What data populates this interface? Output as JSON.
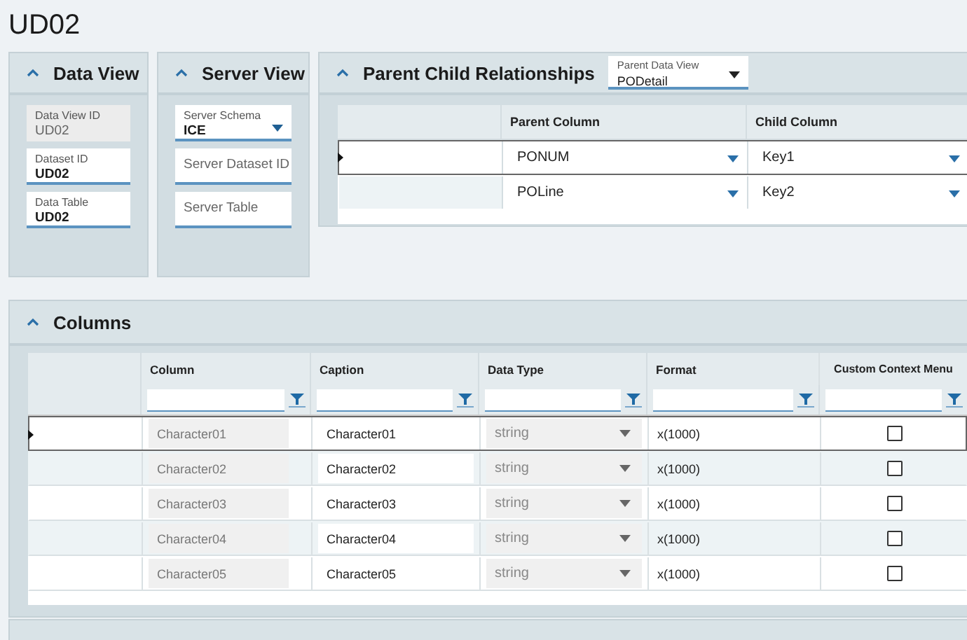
{
  "page": {
    "title": "UD02"
  },
  "data_view": {
    "title": "Data View",
    "fields": [
      {
        "label": "Data View ID",
        "value": "UD02",
        "disabled": true
      },
      {
        "label": "Dataset ID",
        "value": "UD02",
        "disabled": false
      },
      {
        "label": "Data Table",
        "value": "UD02",
        "disabled": false
      }
    ]
  },
  "server_view": {
    "title": "Server View",
    "fields": [
      {
        "kind": "dropdown",
        "label": "Server Schema",
        "value": "ICE"
      },
      {
        "kind": "text",
        "placeholder": "Server Dataset ID"
      },
      {
        "kind": "text",
        "placeholder": "Server Table"
      }
    ]
  },
  "relationships": {
    "title": "Parent Child Relationships",
    "parent_data_view": {
      "label": "Parent Data View",
      "value": "PODetail"
    },
    "columns": [
      "Parent Column",
      "Child Column"
    ],
    "rows": [
      {
        "parent_column": "PONUM",
        "child_column": "Key1",
        "selected": true
      },
      {
        "parent_column": "POLine",
        "child_column": "Key2",
        "selected": false
      }
    ]
  },
  "columns_panel": {
    "title": "Columns",
    "columns": [
      "Column",
      "Caption",
      "Data Type",
      "Format",
      "Custom Context Menu"
    ],
    "rows": [
      {
        "column": "Character01",
        "caption": "Character01",
        "data_type": "string",
        "format": "x(1000)",
        "custom_context_menu": false,
        "selected": true
      },
      {
        "column": "Character02",
        "caption": "Character02",
        "data_type": "string",
        "format": "x(1000)",
        "custom_context_menu": false,
        "selected": false
      },
      {
        "column": "Character03",
        "caption": "Character03",
        "data_type": "string",
        "format": "x(1000)",
        "custom_context_menu": false,
        "selected": false
      },
      {
        "column": "Character04",
        "caption": "Character04",
        "data_type": "string",
        "format": "x(1000)",
        "custom_context_menu": false,
        "selected": false
      },
      {
        "column": "Character05",
        "caption": "Character05",
        "data_type": "string",
        "format": "x(1000)",
        "custom_context_menu": false,
        "selected": false
      }
    ]
  }
}
